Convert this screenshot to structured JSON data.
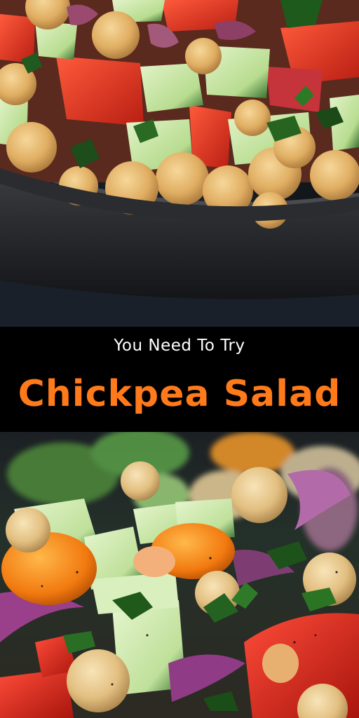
{
  "banner": {
    "tagline": "You Need To Try",
    "title": "Chickpea Salad"
  },
  "colors": {
    "title_accent": "#ff7a1a",
    "banner_background": "#000000",
    "tagline_text": "#ffffff"
  },
  "images": {
    "top": "chickpea-salad-bowl-photo",
    "bottom": "chickpea-salad-closeup-photo"
  }
}
